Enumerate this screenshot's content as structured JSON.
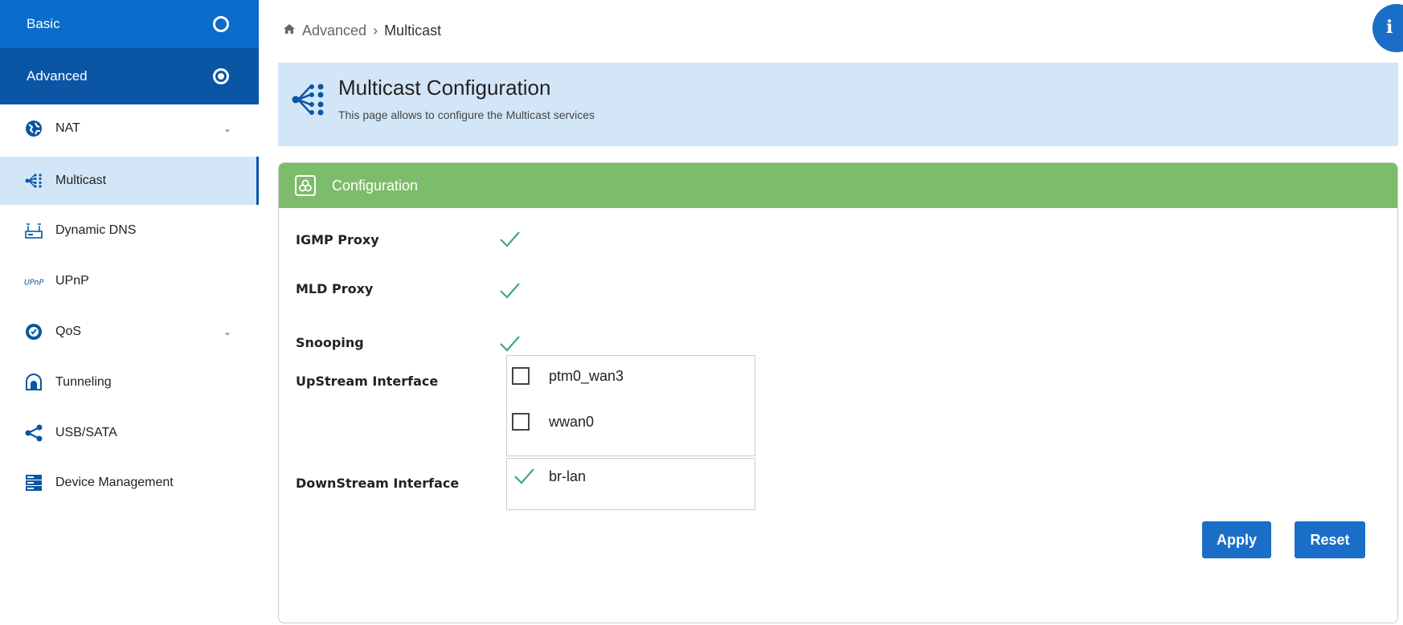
{
  "sidebar": {
    "basic_label": "Basic",
    "advanced_label": "Advanced",
    "items": [
      {
        "label": "NAT",
        "icon": "globe-icon",
        "has_chevron": true
      },
      {
        "label": "Multicast",
        "icon": "multicast-icon",
        "active": true
      },
      {
        "label": "Dynamic DNS",
        "icon": "ddns-icon"
      },
      {
        "label": "UPnP",
        "icon": "upnp-icon"
      },
      {
        "label": "QoS",
        "icon": "qos-icon",
        "has_chevron": true
      },
      {
        "label": "Tunneling",
        "icon": "tunnel-icon"
      },
      {
        "label": "USB/SATA",
        "icon": "share-icon"
      },
      {
        "label": "Device Management",
        "icon": "server-icon"
      }
    ],
    "chevron": "⌄"
  },
  "breadcrumb": {
    "home_icon": "home-icon",
    "parent": "Advanced",
    "separator": "›",
    "current": "Multicast"
  },
  "info_button": {
    "label": "i"
  },
  "header": {
    "title": "Multicast Configuration",
    "subtitle": "This page allows to configure the Multicast services"
  },
  "config": {
    "title": "Configuration",
    "igmp_label": "IGMP Proxy",
    "igmp_enabled": true,
    "mld_label": "MLD Proxy",
    "mld_enabled": true,
    "snooping_label": "Snooping",
    "snooping_enabled": true,
    "upstream_label": "UpStream Interface",
    "upstream_options": [
      {
        "name": "ptm0_wan3",
        "checked": false
      },
      {
        "name": "wwan0",
        "checked": false
      }
    ],
    "downstream_label": "DownStream Interface",
    "downstream_options": [
      {
        "name": "br-lan",
        "checked": true
      }
    ],
    "apply_label": "Apply",
    "reset_label": "Reset"
  },
  "colors": {
    "sidebar_basic": "#0a6ccb",
    "sidebar_advanced": "#0a56a4",
    "active_item": "#d3e6f8",
    "card_header": "#7dbc6a",
    "check": "#3aa890",
    "button": "#1a6ec7"
  }
}
